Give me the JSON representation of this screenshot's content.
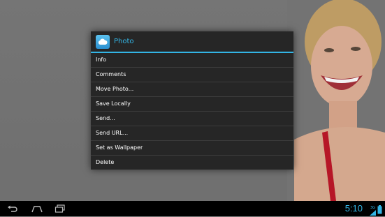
{
  "dialog": {
    "title": "Photo",
    "icon": "cloud-icon",
    "accent_color": "#33b5e5",
    "items": [
      {
        "label": "Info"
      },
      {
        "label": "Comments"
      },
      {
        "label": "Move Photo..."
      },
      {
        "label": "Save Locally"
      },
      {
        "label": "Send..."
      },
      {
        "label": "Send URL..."
      },
      {
        "label": "Set as Wallpaper"
      },
      {
        "label": "Delete"
      }
    ]
  },
  "navbar": {
    "back_icon": "back-icon",
    "home_icon": "home-icon",
    "recents_icon": "recent-apps-icon"
  },
  "status": {
    "time": "5:10",
    "network_label": "3G",
    "signal_icon": "signal-icon",
    "battery_icon": "battery-icon"
  }
}
